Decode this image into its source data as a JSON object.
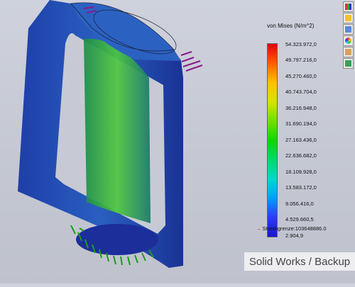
{
  "legend": {
    "title": "von Mises (N/m^2)",
    "ticks": [
      "54.323.972,0",
      "49.797.216,0",
      "45.270.460,0",
      "40.743.704,0",
      "36.216.948,0",
      "31.690.194,0",
      "27.163.436,0",
      "22.636.682,0",
      "18.109.928,0",
      "13.583.172,0",
      "9.056.416,0",
      "4.529.660,5",
      "2.904,9"
    ],
    "colors": [
      "#e3000e",
      "#ff5e00",
      "#ffc000",
      "#d6e400",
      "#6ee100",
      "#12d500",
      "#00d86a",
      "#00d8cc",
      "#009eff",
      "#2b3cf2",
      "#1a13d6"
    ]
  },
  "yield_label": "Streckgrenze:103648886.0",
  "watermark": "Solid Works / Backup",
  "toolbar_icons": [
    "chart-icon",
    "folder-icon",
    "layers-icon",
    "color-wheel-icon",
    "report-icon",
    "probe-icon"
  ],
  "colors": {
    "background": "#c9ccd6",
    "load_arrow": "#8a1a8a",
    "fixture_arrow": "#1c9b1c"
  }
}
